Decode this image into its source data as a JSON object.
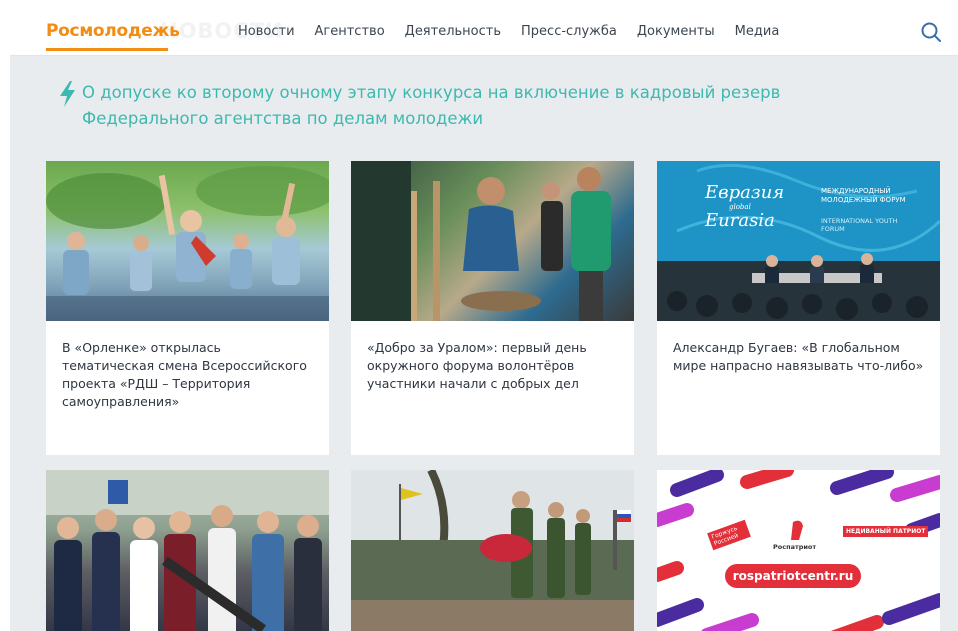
{
  "header": {
    "logo": "Росмолодежь",
    "ghost_text": "НОВОСТИ",
    "nav": [
      "Новости",
      "Агентство",
      "Деятельность",
      "Пресс-служба",
      "Документы",
      "Медиа"
    ]
  },
  "headline": {
    "icon": "lightning-icon",
    "text": "О допуске ко второму очному этапу конкурса на включение в кадровый резерв Федерального агентства по делам молодежи"
  },
  "cards": [
    {
      "title": "В «Орленке» открылась тематическая смена Всероссийского проекта «РДШ – Территория самоуправления»"
    },
    {
      "title": "«Добро за Уралом»: первый день окружного форума волонтёров участники начали с добрых дел"
    },
    {
      "title": "Александр Бугаев: «В глобальном мире напрасно навязывать что-либо»",
      "image_text": {
        "title_line1": "Евразия",
        "title_line2": "Eurasia",
        "global": "global",
        "sub": "МЕЖДУНАРОДНЫЙ МОЛОДЕЖНЫЙ ФОРУМ",
        "sub_en": "INTERNATIONAL YOUTH FORUM"
      }
    },
    {
      "title": ""
    },
    {
      "title": ""
    },
    {
      "title": "",
      "image_text": {
        "url": "rospatriotcentr.ru",
        "logo": "Роспатриот",
        "tag_left": "Горжусь Россией",
        "tag_right": "НЕДИВАНЫЙ ПАТРИОТ"
      }
    }
  ],
  "colors": {
    "brand_orange": "#f28c12",
    "headline_teal": "#3cb9b0",
    "background": "#e9ecee",
    "promo_red": "#e22f3a"
  }
}
